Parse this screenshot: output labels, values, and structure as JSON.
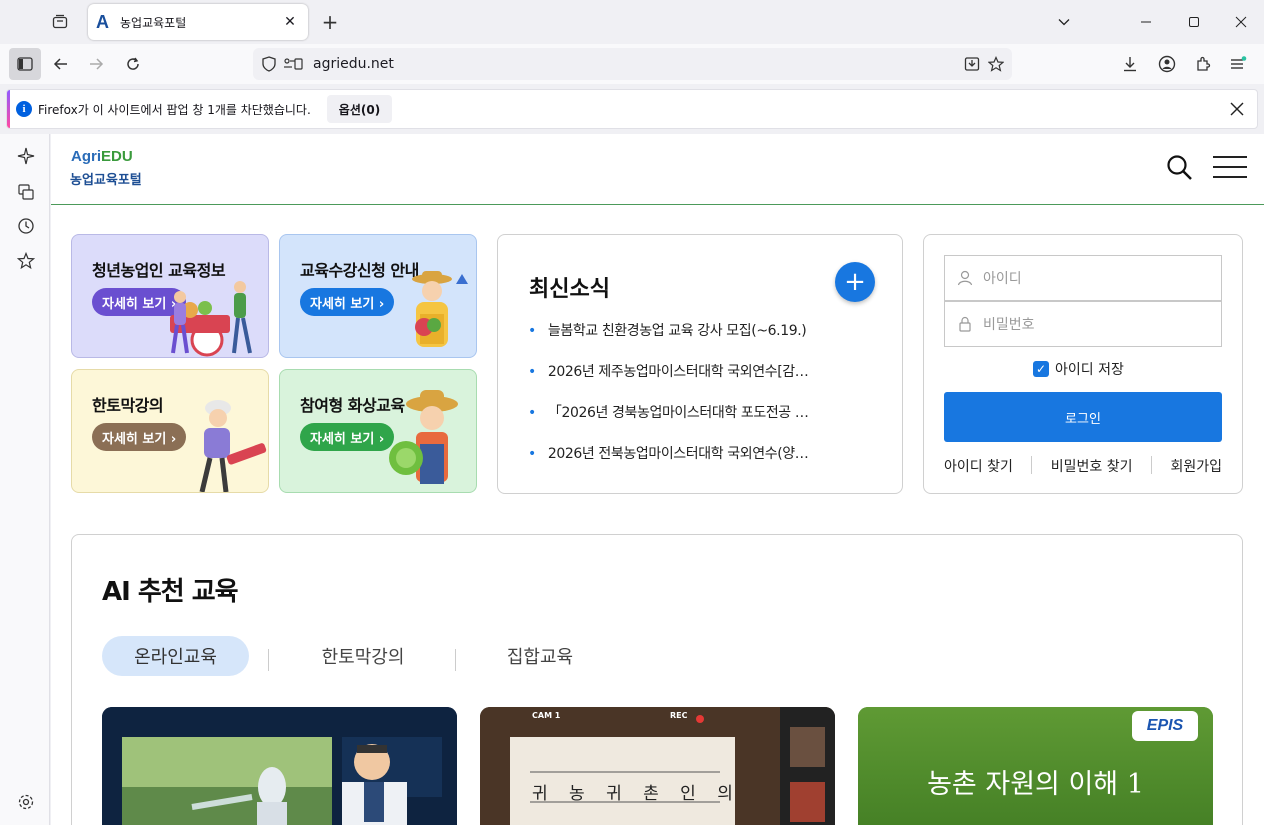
{
  "browser": {
    "tab_title": "농업교육포털",
    "tab_favicon": "A",
    "url": "agriedu.net",
    "notification": {
      "text": "Firefox가 이 사이트에서 팝업 창 1개를 차단했습니다.",
      "button": "옵션(0)"
    }
  },
  "site": {
    "logo_top_a": "Agri",
    "logo_top_b": "EDU",
    "logo_bottom": "농업교육포털"
  },
  "cards": [
    {
      "title": "청년농업인 교육정보",
      "button": "자세히 보기 ›",
      "bg": "#dcdcfa",
      "btn_color": "#6a4fd0"
    },
    {
      "title": "교육수강신청 안내",
      "button": "자세히 보기 ›",
      "bg": "#d3e4fb",
      "btn_color": "#1877e0"
    },
    {
      "title": "한토막강의",
      "button": "자세히 보기 ›",
      "bg": "#fdf7d8",
      "btn_color": "#8b6f55"
    },
    {
      "title": "참여형 화상교육",
      "button": "자세히 보기 ›",
      "bg": "#d9f3dc",
      "btn_color": "#2fa54a"
    }
  ],
  "news": {
    "title": "최신소식",
    "items": [
      "늘봄학교 친환경농업 교육 강사 모집(~6.19.)",
      "2026년 제주농업마이스터대학 국외연수[감…",
      "「2026년 경북농업마이스터대학 포도전공 …",
      "2026년 전북농업마이스터대학 국외연수(양…"
    ]
  },
  "login": {
    "id_placeholder": "아이디",
    "pw_placeholder": "비밀번호",
    "save_id": "아이디 저장",
    "login_button": "로그인",
    "links": [
      "아이디 찾기",
      "비밀번호 찾기",
      "회원가입"
    ]
  },
  "ai": {
    "title": "AI 추천 교육",
    "tabs": [
      "온라인교육",
      "한토막강의",
      "집합교육"
    ],
    "thumb3_text": "농촌 자원의 이해 1",
    "thumb3_badge": "EPIS",
    "thumb2_text1": "귀 농 귀 촌 인 의",
    "thumb2_cam": "CAM 1",
    "thumb2_rec": "REC"
  }
}
